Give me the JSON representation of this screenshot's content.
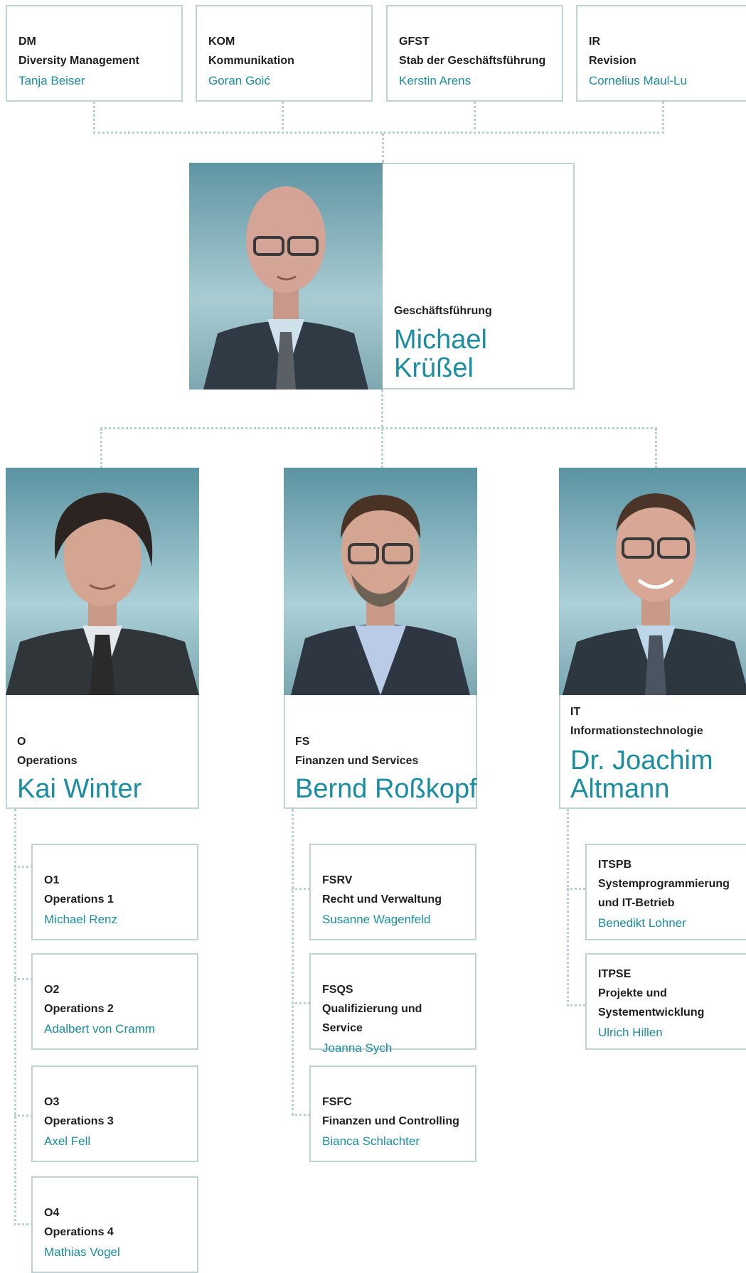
{
  "colors": {
    "accent": "#1a8ea0",
    "border": "#bfd3d6",
    "connector": "#b9d0d4",
    "text": "#1f1f1f"
  },
  "top_units": [
    {
      "code": "DM",
      "dept": "Diversity Management",
      "name": "Tanja Beiser"
    },
    {
      "code": "KOM",
      "dept": "Kommunikation",
      "name": "Goran Goić"
    },
    {
      "code": "GFST",
      "dept": "Stab der Geschäftsführung",
      "name": "Kerstin Arens"
    },
    {
      "code": "IR",
      "dept": "Revision",
      "name": "Cornelius Maul-Lu"
    }
  ],
  "ceo": {
    "title": "Geschäftsführung",
    "first": "Michael",
    "last": "Krüßel",
    "photo_icon": "portrait-photo"
  },
  "divisions": [
    {
      "code": "O",
      "dept": "Operations",
      "name": "Kai Winter",
      "units": [
        {
          "code": "O1",
          "dept": "Operations 1",
          "name": "Michael Renz"
        },
        {
          "code": "O2",
          "dept": "Operations 2",
          "name": "Adalbert von Cramm"
        },
        {
          "code": "O3",
          "dept": "Operations 3",
          "name": "Axel Fell"
        },
        {
          "code": "O4",
          "dept": "Operations 4",
          "name": "Mathias Vogel"
        }
      ]
    },
    {
      "code": "FS",
      "dept": "Finanzen und Services",
      "name": "Bernd Roßkopf",
      "units": [
        {
          "code": "FSRV",
          "dept": "Recht und Verwaltung",
          "name": "Susanne Wagenfeld"
        },
        {
          "code": "FSQS",
          "dept": "Qualifizierung und Service",
          "name": "Joanna Sych"
        },
        {
          "code": "FSFC",
          "dept": "Finanzen und Controlling",
          "name": "Bianca Schlachter"
        }
      ]
    },
    {
      "code": "IT",
      "dept": "Informationstechnologie",
      "name_line1": "Dr. Joachim",
      "name_line2": "Altmann",
      "units": [
        {
          "code": "ITSPB",
          "dept_line1": "Systemprogrammierung",
          "dept_line2": "und IT-Betrieb",
          "name": "Benedikt Lohner"
        },
        {
          "code": "ITPSE",
          "dept_line1": "Projekte und",
          "dept_line2": "Systementwicklung",
          "name": "Ulrich Hillen"
        }
      ]
    }
  ]
}
